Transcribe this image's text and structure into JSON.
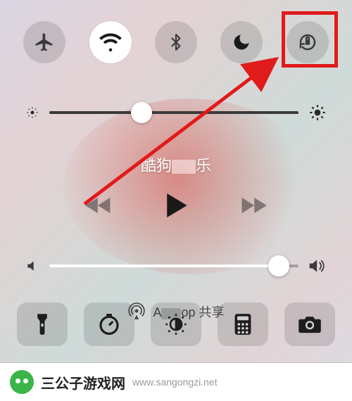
{
  "toggles": {
    "airplane": {
      "on": false,
      "icon": "airplane-mode-icon"
    },
    "wifi": {
      "on": true,
      "icon": "wifi-icon"
    },
    "bluetooth": {
      "on": false,
      "icon": "bluetooth-icon"
    },
    "dnd": {
      "on": false,
      "icon": "do-not-disturb-icon"
    },
    "lock": {
      "on": false,
      "icon": "rotation-lock-icon"
    }
  },
  "brightness": {
    "value": 37
  },
  "now_playing": {
    "prefix": "酷狗",
    "suffix": "乐"
  },
  "volume": {
    "value": 92
  },
  "airdrop": {
    "label_prefix": "A",
    "label_suffix": "op 共享"
  },
  "shortcuts": [
    {
      "name": "flashlight"
    },
    {
      "name": "timer"
    },
    {
      "name": "night-shift"
    },
    {
      "name": "calculator"
    },
    {
      "name": "camera"
    }
  ],
  "highlight": {
    "target": "rotation-lock-toggle",
    "color": "#e11b1b"
  },
  "watermark": {
    "title": "三公子游戏网",
    "url": "www.sangongzi.net"
  }
}
